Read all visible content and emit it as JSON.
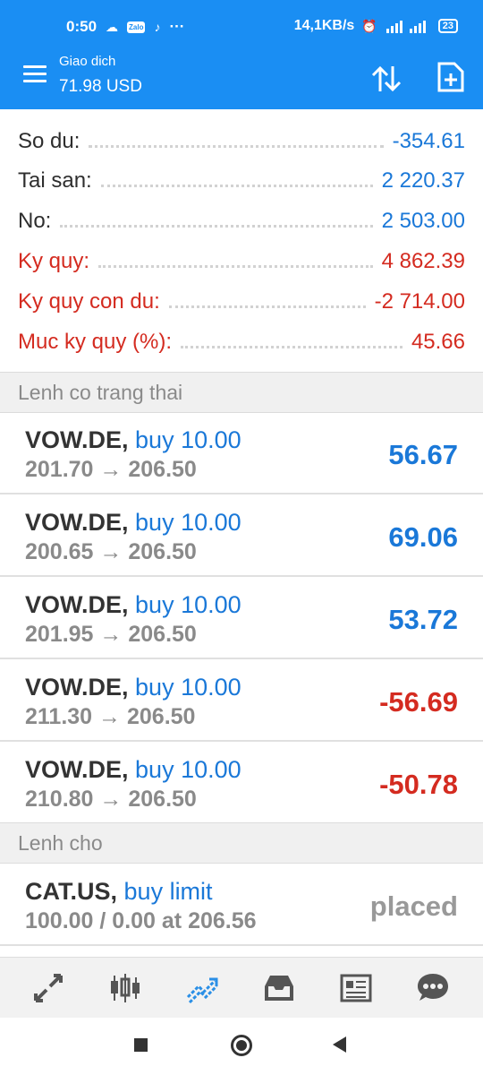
{
  "statusbar": {
    "time": "0:50",
    "dots": "···",
    "network_speed": "14,1KB/s",
    "battery": "23"
  },
  "header": {
    "title": "Giao dich",
    "subtitle": "71.98 USD"
  },
  "summary": [
    {
      "label": "So du:",
      "value": "-354.61"
    },
    {
      "label": "Tai san:",
      "value": "2 220.37"
    },
    {
      "label": "No:",
      "value": "2 503.00"
    },
    {
      "label": "Ky quy:",
      "value": "4 862.39"
    },
    {
      "label": "Ky quy con du:",
      "value": "-2 714.00"
    },
    {
      "label": "Muc ky quy (%):",
      "value": "45.66"
    }
  ],
  "open_positions": {
    "header": "Lenh co trang thai",
    "items": [
      {
        "symbol": "VOW.DE,",
        "side": "buy 10.00",
        "prices": "201.70 → 206.50",
        "profit": "56.67"
      },
      {
        "symbol": "VOW.DE,",
        "side": "buy 10.00",
        "prices": "200.65 → 206.50",
        "profit": "69.06"
      },
      {
        "symbol": "VOW.DE,",
        "side": "buy 10.00",
        "prices": "201.95 → 206.50",
        "profit": "53.72"
      },
      {
        "symbol": "VOW.DE,",
        "side": "buy 10.00",
        "prices": "211.30 → 206.50",
        "profit": "-56.69"
      },
      {
        "symbol": "VOW.DE,",
        "side": "buy 10.00",
        "prices": "210.80 → 206.50",
        "profit": "-50.78"
      }
    ]
  },
  "pending_orders": {
    "header": "Lenh cho",
    "items": [
      {
        "symbol": "CAT.US,",
        "side": "buy limit",
        "details": "100.00 / 0.00 at 206.56",
        "status": "placed"
      }
    ]
  },
  "colors": {
    "accent": "#1a8ef3",
    "positive": "#1a78d8",
    "negative": "#d42b20"
  },
  "tabs": [
    "quotes-icon",
    "chart-icon",
    "trade-icon",
    "history-icon",
    "news-icon",
    "messages-icon"
  ]
}
